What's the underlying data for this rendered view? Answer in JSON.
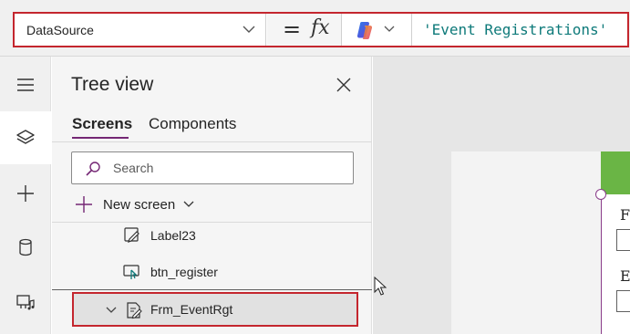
{
  "formula_bar": {
    "property": "DataSource",
    "equals": "=",
    "fx": "fx",
    "formula": "'Event Registrations'"
  },
  "rail": {
    "items": [
      {
        "icon": "hamburger-icon",
        "active": false
      },
      {
        "icon": "layers-icon",
        "active": true
      },
      {
        "icon": "plus-icon",
        "active": false
      },
      {
        "icon": "database-icon",
        "active": false
      },
      {
        "icon": "media-icon",
        "active": false
      }
    ]
  },
  "tree_view": {
    "title": "Tree view",
    "tabs": [
      {
        "label": "Screens",
        "active": true
      },
      {
        "label": "Components",
        "active": false
      }
    ],
    "search": {
      "placeholder": "Search",
      "value": ""
    },
    "new_screen_label": "New screen",
    "nodes": [
      {
        "label": "Label23",
        "icon": "label-icon"
      },
      {
        "label": "btn_register",
        "icon": "button-icon"
      }
    ],
    "selected_node": {
      "label": "Frm_EventRgt",
      "icon": "form-icon",
      "expanded": true
    }
  },
  "canvas": {
    "field_letters": [
      "F",
      "E"
    ]
  },
  "colors": {
    "accent": "#742774",
    "highlight_border": "#c4262e",
    "formula_text": "#0e7a7a",
    "header_green": "#6ab545"
  }
}
